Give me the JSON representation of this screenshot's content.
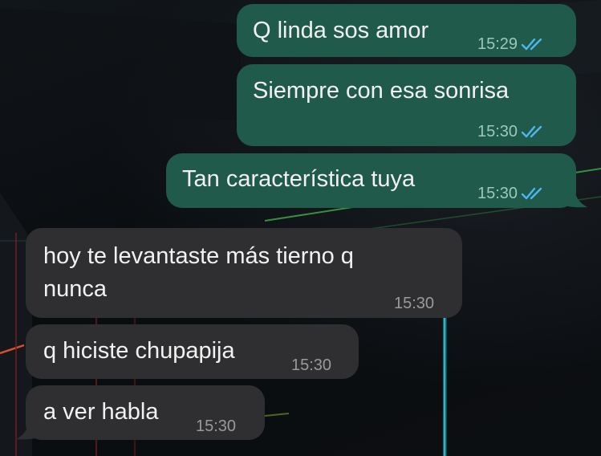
{
  "chat": {
    "messages": [
      {
        "direction": "outgoing",
        "text": "Q linda sos amor",
        "time": "15:29",
        "status": "read"
      },
      {
        "direction": "outgoing",
        "text": "Siempre con esa sonrisa",
        "time": "15:30",
        "status": "read"
      },
      {
        "direction": "outgoing",
        "text": "Tan característica tuya",
        "time": "15:30",
        "status": "read"
      },
      {
        "direction": "incoming",
        "text_line1": "hoy te levantaste más tierno q",
        "text_line2": "nunca",
        "time": "15:30"
      },
      {
        "direction": "incoming",
        "text": "q hiciste chupapija",
        "time": "15:30"
      },
      {
        "direction": "incoming",
        "text": "a ver habla",
        "time": "15:30"
      }
    ]
  },
  "colors": {
    "outgoing_bubble": "#1f5a4b",
    "incoming_bubble": "#2f2f31",
    "read_ticks": "#4fb6ec",
    "text": "#f1f1f1"
  },
  "icons": {
    "read_receipt": "double-check-icon"
  }
}
